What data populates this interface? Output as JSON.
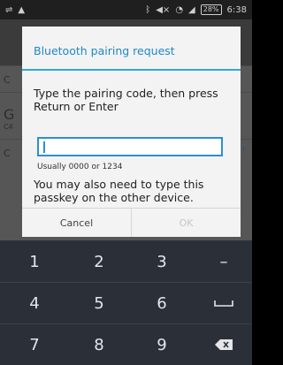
{
  "status_bar": {
    "left_icons": [
      "usb-icon",
      "warning-icon"
    ],
    "right_icons": [
      "bluetooth-icon",
      "mute-icon",
      "wifi-icon",
      "signal-icon"
    ],
    "battery": "28%",
    "time": "6:38"
  },
  "dialog": {
    "title": "Bluetooth pairing request",
    "message": "Type the pairing code, then press Return or Enter",
    "input_value": "",
    "hint": "Usually 0000 or 1234",
    "extra": "You may also need to type this passkey on the other device.",
    "cancel_label": "Cancel",
    "ok_label": "OK"
  },
  "keyboard": {
    "rows": [
      [
        "1",
        "2",
        "3",
        "–"
      ],
      [
        "4",
        "5",
        "6",
        "space"
      ],
      [
        "7",
        "8",
        "9",
        "backspace"
      ]
    ]
  },
  "colors": {
    "accent": "#33a6dc",
    "keyboard_bg": "#2b3038",
    "dialog_bg": "#f3f3f3"
  }
}
